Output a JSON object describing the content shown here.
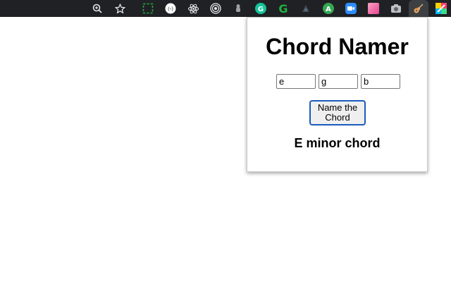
{
  "toolbar": {
    "extensions": [
      {
        "name": "zoom-icon"
      },
      {
        "name": "bookmark-star-icon"
      },
      {
        "name": "screenshot-selection-icon"
      },
      {
        "name": "bracket-extension-icon",
        "glyph": "(-)"
      },
      {
        "name": "react-devtools-icon"
      },
      {
        "name": "target-rings-icon"
      },
      {
        "name": "pin-extension-icon"
      },
      {
        "name": "grammarly-icon",
        "glyph": "G",
        "color": "#15c39a"
      },
      {
        "name": "grammar-g-icon",
        "glyph": "G",
        "color": "#1fb141"
      },
      {
        "name": "dark-extension-icon"
      },
      {
        "name": "green-a-icon",
        "glyph": "A",
        "color": "#34a853"
      },
      {
        "name": "zoom-video-icon",
        "color": "#2d8cff"
      },
      {
        "name": "pink-square-icon",
        "color": "#f06292"
      },
      {
        "name": "camera-icon"
      },
      {
        "name": "guitar-icon"
      },
      {
        "name": "colorful-extension-icon"
      }
    ]
  },
  "popup": {
    "title": "Chord Namer",
    "notes": [
      "e",
      "g",
      "b"
    ],
    "button_label": "Name the Chord",
    "result": "E minor chord"
  },
  "colors": {
    "toolbar_bg": "#202124",
    "button_border": "#1a5bbd"
  }
}
